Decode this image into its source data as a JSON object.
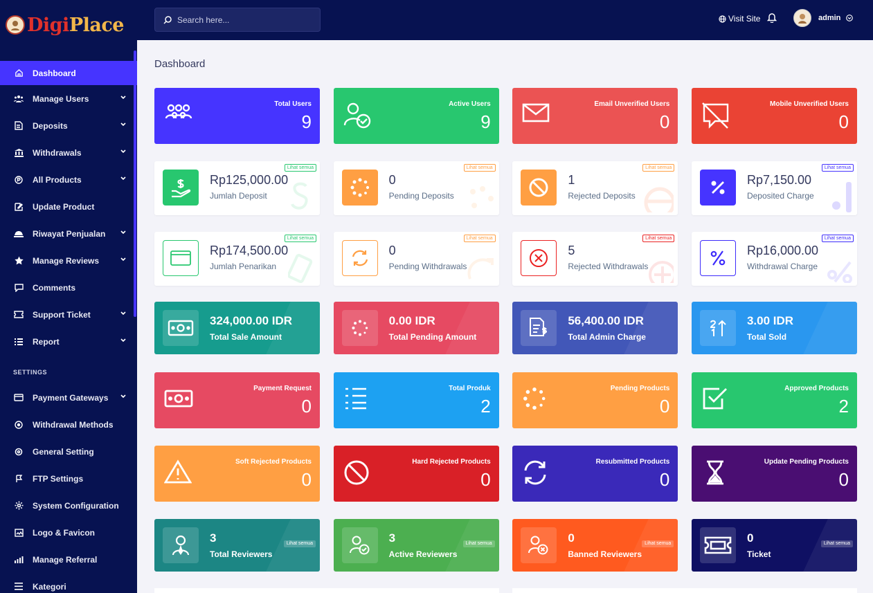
{
  "app": {
    "logo_digi": "Digi",
    "logo_place": "Place"
  },
  "header": {
    "search_placeholder": "Search here...",
    "visit_site": "Visit Site",
    "user_name": "admin"
  },
  "sidebar": {
    "items": [
      {
        "label": "Dashboard",
        "icon": "home-icon"
      },
      {
        "label": "Manage Users",
        "icon": "users-icon"
      },
      {
        "label": "Deposits",
        "icon": "deposit-icon"
      },
      {
        "label": "Withdrawals",
        "icon": "bank-icon"
      },
      {
        "label": "All Products",
        "icon": "product-icon"
      },
      {
        "label": "Update Product",
        "icon": "edit-icon"
      },
      {
        "label": "Riwayat Penjualan",
        "icon": "sales-icon"
      },
      {
        "label": "Manage Reviews",
        "icon": "star-icon"
      },
      {
        "label": "Comments",
        "icon": "comment-icon"
      },
      {
        "label": "Support Ticket",
        "icon": "ticket-icon"
      },
      {
        "label": "Report",
        "icon": "report-icon"
      }
    ],
    "settings_title": "SETTINGS",
    "settings": [
      {
        "label": "Payment Gateways",
        "icon": "card-icon"
      },
      {
        "label": "Withdrawal Methods",
        "icon": "methods-icon"
      },
      {
        "label": "General Setting",
        "icon": "settings-icon"
      },
      {
        "label": "FTP Settings",
        "icon": "ftp-icon"
      },
      {
        "label": "System Configuration",
        "icon": "config-icon"
      },
      {
        "label": "Logo & Favicon",
        "icon": "image-icon"
      },
      {
        "label": "Manage Referral",
        "icon": "referral-icon"
      },
      {
        "label": "Kategori",
        "icon": "list-icon"
      }
    ]
  },
  "page": {
    "title": "Dashboard"
  },
  "more_label": "Lihat semua",
  "users": [
    {
      "label": "Total Users",
      "value": "9",
      "color": "#4634ff"
    },
    {
      "label": "Active Users",
      "value": "9",
      "color": "#28c76f"
    },
    {
      "label": "Email Unverified Users",
      "value": "0",
      "color": "#eb5353"
    },
    {
      "label": "Mobile Unverified Users",
      "value": "0",
      "color": "#ea4334"
    }
  ],
  "deposits": [
    {
      "value": "Rp125,000.00",
      "label": "Jumlah Deposit",
      "color": "#28c76f"
    },
    {
      "value": "0",
      "label": "Pending Deposits",
      "color": "#ff9f43"
    },
    {
      "value": "1",
      "label": "Rejected Deposits",
      "color": "#ff9f43"
    },
    {
      "value": "Rp7,150.00",
      "label": "Deposited Charge",
      "color": "#4634ff"
    }
  ],
  "withdrawals": [
    {
      "value": "Rp174,500.00",
      "label": "Jumlah Penarikan",
      "color": "#28c76f"
    },
    {
      "value": "0",
      "label": "Pending Withdrawals",
      "color": "#ff9f43"
    },
    {
      "value": "5",
      "label": "Rejected Withdrawals",
      "color": "#eb2222"
    },
    {
      "value": "Rp16,000.00",
      "label": "Withdrawal Charge",
      "color": "#3d2bfb"
    }
  ],
  "sales": [
    {
      "value": "324,000.00 IDR",
      "label": "Total Sale Amount",
      "color": "#169c8e"
    },
    {
      "value": "0.00 IDR",
      "label": "Total Pending Amount",
      "color": "#e64a62"
    },
    {
      "value": "56,400.00 IDR",
      "label": "Total Admin Charge",
      "color": "#4257b8"
    },
    {
      "value": "3.00 IDR",
      "label": "Total Sold",
      "color": "#2a97ef"
    }
  ],
  "products": [
    {
      "label": "Payment Request",
      "value": "0",
      "color": "#e64a62"
    },
    {
      "label": "Total Produk",
      "value": "2",
      "color": "#1da1f2"
    },
    {
      "label": "Pending Products",
      "value": "0",
      "color": "#ff9f43"
    },
    {
      "label": "Approved Products",
      "value": "2",
      "color": "#28c76f"
    }
  ],
  "product_status": [
    {
      "label": "Soft Rejected Products",
      "value": "0",
      "color": "#ff9f43"
    },
    {
      "label": "Hard Rejected Products",
      "value": "0",
      "color": "#d92027"
    },
    {
      "label": "Resubmitted Products",
      "value": "0",
      "color": "#3a29b9"
    },
    {
      "label": "Update Pending Products",
      "value": "0",
      "color": "#4a0e72"
    }
  ],
  "reviewers": [
    {
      "value": "3",
      "label": "Total Reviewers",
      "color": "#1c8684"
    },
    {
      "value": "3",
      "label": "Active Reviewers",
      "color": "#4caf50"
    },
    {
      "value": "0",
      "label": "Banned Reviewers",
      "color": "#ff5a1f"
    },
    {
      "value": "0",
      "label": "Ticket",
      "color": "#0f1063"
    }
  ]
}
